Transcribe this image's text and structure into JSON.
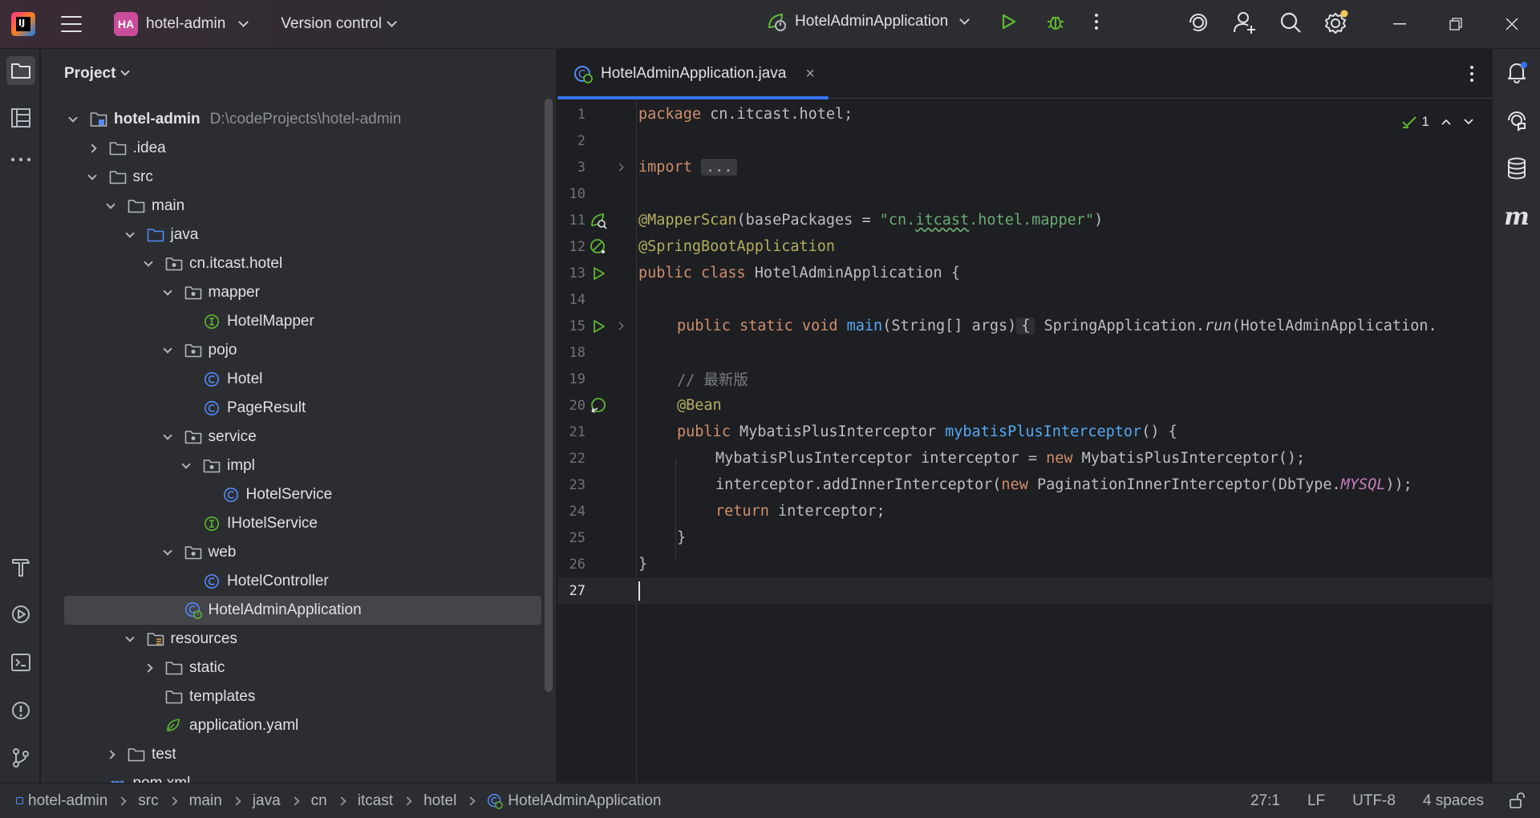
{
  "titlebar": {
    "project_badge": "HA",
    "project_name": "hotel-admin",
    "vcs_label": "Version control",
    "run_config": "HotelAdminApplication"
  },
  "project_panel": {
    "title": "Project",
    "root_name": "hotel-admin",
    "root_path": "D:\\codeProjects\\hotel-admin",
    "tree": [
      {
        "label": "hotel-admin",
        "depth": 0,
        "expanded": true,
        "icon": "module-folder-icon"
      },
      {
        "label": ".idea",
        "depth": 1,
        "expanded": false,
        "icon": "folder-icon"
      },
      {
        "label": "src",
        "depth": 1,
        "expanded": true,
        "icon": "folder-icon"
      },
      {
        "label": "main",
        "depth": 2,
        "expanded": true,
        "icon": "folder-icon"
      },
      {
        "label": "java",
        "depth": 3,
        "expanded": true,
        "icon": "source-folder-icon"
      },
      {
        "label": "cn.itcast.hotel",
        "depth": 4,
        "expanded": true,
        "icon": "package-icon"
      },
      {
        "label": "mapper",
        "depth": 5,
        "expanded": true,
        "icon": "package-icon"
      },
      {
        "label": "HotelMapper",
        "depth": 6,
        "icon": "interface-icon"
      },
      {
        "label": "pojo",
        "depth": 5,
        "expanded": true,
        "icon": "package-icon"
      },
      {
        "label": "Hotel",
        "depth": 6,
        "icon": "class-icon"
      },
      {
        "label": "PageResult",
        "depth": 6,
        "icon": "class-icon"
      },
      {
        "label": "service",
        "depth": 5,
        "expanded": true,
        "icon": "package-icon"
      },
      {
        "label": "impl",
        "depth": 6,
        "expanded": true,
        "icon": "package-icon"
      },
      {
        "label": "HotelService",
        "depth": 7,
        "icon": "class-icon"
      },
      {
        "label": "IHotelService",
        "depth": 6,
        "icon": "interface-icon"
      },
      {
        "label": "web",
        "depth": 5,
        "expanded": true,
        "icon": "package-icon"
      },
      {
        "label": "HotelController",
        "depth": 6,
        "icon": "class-icon"
      },
      {
        "label": "HotelAdminApplication",
        "depth": 5,
        "icon": "spring-boot-class-icon",
        "selected": true
      },
      {
        "label": "resources",
        "depth": 3,
        "expanded": true,
        "icon": "resources-folder-icon"
      },
      {
        "label": "static",
        "depth": 4,
        "expanded": false,
        "icon": "folder-icon"
      },
      {
        "label": "templates",
        "depth": 4,
        "icon": "folder-icon"
      },
      {
        "label": "application.yaml",
        "depth": 4,
        "icon": "spring-config-icon"
      },
      {
        "label": "test",
        "depth": 2,
        "expanded": false,
        "icon": "folder-icon"
      },
      {
        "label": "pom.xml",
        "depth": 1,
        "icon": "maven-icon"
      }
    ]
  },
  "editor": {
    "tab_label": "HotelAdminApplication.java",
    "inspection_count": "1",
    "current_line": "27",
    "lines": [
      {
        "n": "1"
      },
      {
        "n": "2"
      },
      {
        "n": "3"
      },
      {
        "n": "10"
      },
      {
        "n": "11"
      },
      {
        "n": "12"
      },
      {
        "n": "13"
      },
      {
        "n": "14"
      },
      {
        "n": "15"
      },
      {
        "n": "18"
      },
      {
        "n": "19"
      },
      {
        "n": "20"
      },
      {
        "n": "21"
      },
      {
        "n": "22"
      },
      {
        "n": "23"
      },
      {
        "n": "24"
      },
      {
        "n": "25"
      },
      {
        "n": "26"
      },
      {
        "n": "27"
      }
    ],
    "code": {
      "l1_kw": "package",
      "l1_rest": " cn.itcast.hotel;",
      "l3_kw": "import",
      "l3_fold": "...",
      "l11_ann": "@MapperScan",
      "l11_a": "(basePackages = ",
      "l11_s1": "\"cn.",
      "l11_s2": "itcast",
      "l11_s3": ".hotel.mapper\"",
      "l11_b": ")",
      "l12_ann": "@SpringBootApplication",
      "l13_kw": "public class",
      "l13_rest": " HotelAdminApplication {",
      "l15_kw": "public static void",
      "l15_fn": "main",
      "l15_a": "(String[] args)",
      "l15_brace": "{",
      "l15_b": " SpringApplication.",
      "l15_run": "run",
      "l15_c": "(HotelAdminApplication.",
      "l19_cmt": "// 最新版",
      "l20_ann": "@Bean",
      "l21_kw": "public",
      "l21_type": " MybatisPlusInterceptor ",
      "l21_fn": "mybatisPlusInterceptor",
      "l21_rest": "() {",
      "l22_a": "MybatisPlusInterceptor interceptor = ",
      "l22_kw": "new",
      "l22_b": " MybatisPlusInterceptor();",
      "l23_a": "interceptor.addInnerInterceptor(",
      "l23_kw": "new",
      "l23_b": " PaginationInnerInterceptor(DbType.",
      "l23_cst": "MYSQL",
      "l23_c": "));",
      "l24_kw": "return",
      "l24_rest": " interceptor;",
      "l25": "}",
      "l26": "}"
    }
  },
  "statusbar": {
    "breadcrumbs": [
      "hotel-admin",
      "src",
      "main",
      "java",
      "cn",
      "itcast",
      "hotel",
      "HotelAdminApplication"
    ],
    "position": "27:1",
    "line_sep": "LF",
    "encoding": "UTF-8",
    "indent": "4 spaces"
  },
  "colors": {
    "accent": "#3574f0",
    "background": "#1e1f22",
    "panel": "#2b2d30",
    "keyword": "#cf8e6d",
    "annotation": "#b3ae60",
    "string": "#6aab73",
    "function": "#56a8f5"
  }
}
